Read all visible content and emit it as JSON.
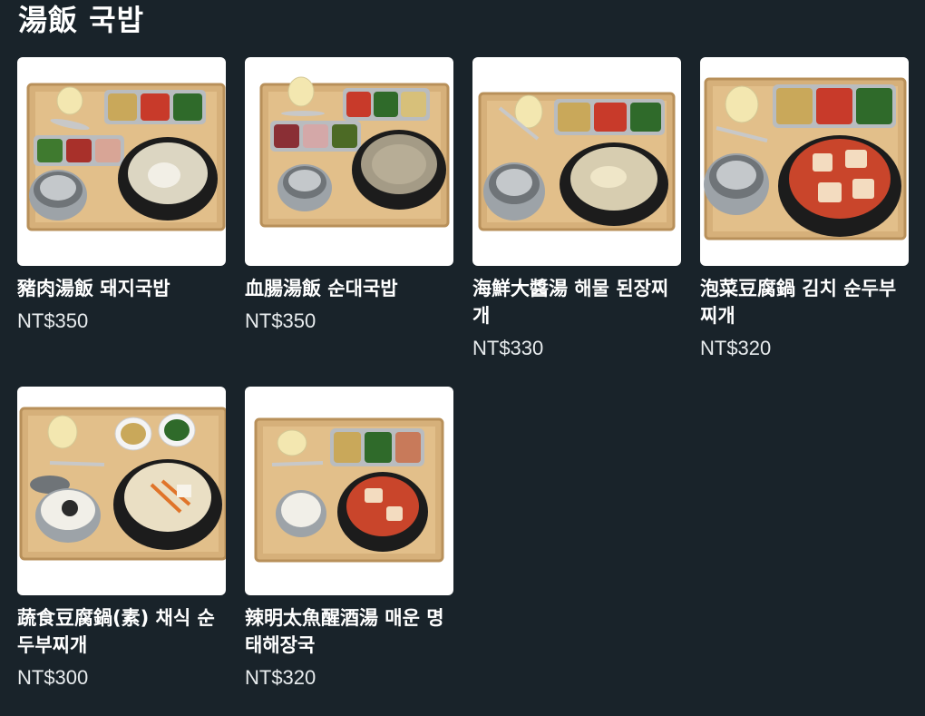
{
  "section": {
    "title": "湯飯 국밥"
  },
  "menu_items": [
    {
      "name": "豬肉湯飯 돼지국밥",
      "price": "NT$350",
      "image": "pork-soup-rice-set-photo"
    },
    {
      "name": "血腸湯飯 순대국밥",
      "price": "NT$350",
      "image": "blood-sausage-soup-rice-set-photo"
    },
    {
      "name": "海鮮大醬湯 해물 된장찌개",
      "price": "NT$330",
      "image": "seafood-soybean-stew-set-photo"
    },
    {
      "name": "泡菜豆腐鍋 김치 순두부찌개",
      "price": "NT$320",
      "image": "kimchi-tofu-stew-set-photo"
    },
    {
      "name": "蔬食豆腐鍋(素) 채식 순두부찌개",
      "price": "NT$300",
      "image": "vegetable-tofu-stew-set-photo"
    },
    {
      "name": "辣明太魚醒酒湯 매운 명태해장국",
      "price": "NT$320",
      "image": "spicy-pollock-soup-set-photo"
    }
  ]
}
